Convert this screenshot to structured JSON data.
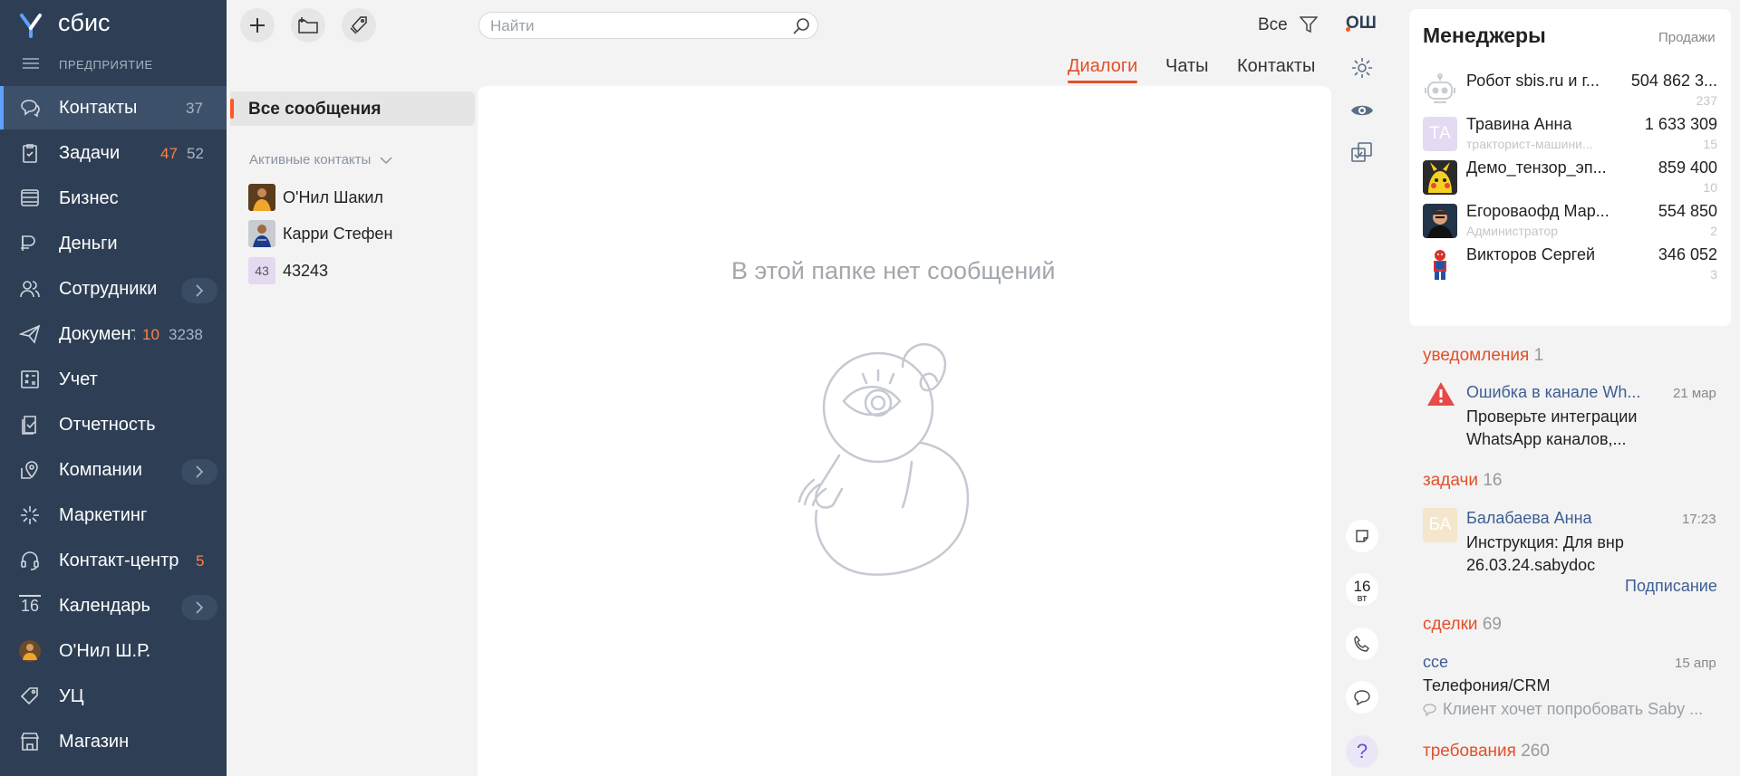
{
  "app": {
    "logo_text": "сбис",
    "org_label": "ПРЕДПРИЯТИЕ"
  },
  "sidebar": {
    "items": [
      {
        "label": "Контакты",
        "count": "37",
        "icon": "chat-bubbles-icon",
        "active": true
      },
      {
        "label": "Задачи",
        "count_alert": "47",
        "count": "52",
        "icon": "clipboard-check-icon"
      },
      {
        "label": "Бизнес",
        "icon": "stack-icon"
      },
      {
        "label": "Деньги",
        "icon": "coins-icon"
      },
      {
        "label": "Сотрудники",
        "icon": "people-icon",
        "expandable": true
      },
      {
        "label": "Документы",
        "count_alert": "10",
        "count": "3238",
        "icon": "send-icon"
      },
      {
        "label": "Учет",
        "icon": "calculator-icon"
      },
      {
        "label": "Отчетность",
        "icon": "report-icon"
      },
      {
        "label": "Компании",
        "icon": "location-building-icon",
        "expandable": true
      },
      {
        "label": "Маркетинг",
        "icon": "sparkle-icon"
      },
      {
        "label": "Контакт-центр",
        "count_alert": "5",
        "icon": "headset-icon"
      },
      {
        "label": "Календарь",
        "day": "16",
        "icon": "calendar-icon",
        "expandable": true
      },
      {
        "label": "О'Нил Ш.Р.",
        "icon": "user-avatar"
      },
      {
        "label": "УЦ",
        "icon": "tag-icon"
      },
      {
        "label": "Магазин",
        "icon": "shop-icon"
      }
    ]
  },
  "toolbar": {
    "search_placeholder": "Найти",
    "filter_label": "Все",
    "user_initials": "ОШ"
  },
  "tabs": [
    "Диалоги",
    "Чаты",
    "Контакты"
  ],
  "folders": {
    "all_messages": "Все сообщения",
    "active_contacts": "Активные контакты"
  },
  "contacts": [
    {
      "name": "О'Нил Шакил"
    },
    {
      "name": "Карри Стефен"
    },
    {
      "name": "43243",
      "badge": "43"
    }
  ],
  "main": {
    "empty_text": "В этой папке нет сообщений"
  },
  "rail": {
    "calendar_day": "16",
    "calendar_weekday": "вт",
    "help": "?"
  },
  "managers": {
    "title": "Менеджеры",
    "filter": "Продажи",
    "rows": [
      {
        "name": "Робот sbis.ru и г...",
        "sub": "",
        "sum": "504 862 3...",
        "n": "237"
      },
      {
        "name": "Травина Анна",
        "sub": "тракторист-машини...",
        "initials": "ТА",
        "sum": "1 633 309",
        "n": "15"
      },
      {
        "name": "Демо_тензор_эп...",
        "sub": "",
        "sum": "859 400",
        "n": "10"
      },
      {
        "name": "Егороваофд Мар...",
        "sub": "Администратор",
        "sum": "554 850",
        "n": "2"
      },
      {
        "name": "Викторов Сергей",
        "sub": "",
        "sum": "346 052",
        "n": "3"
      }
    ]
  },
  "feed": {
    "notifications": {
      "label": "уведомления",
      "count": "1",
      "title": "Ошибка в канале Wh...",
      "date": "21 мар",
      "text": "Проверьте интеграции WhatsApp каналов,..."
    },
    "tasks": {
      "label": "задачи",
      "count": "16",
      "initials": "БА",
      "title": "Балабаева Анна",
      "time": "17:23",
      "text": "Инструкция: Для внр 26.03.24.sabydoc",
      "action": "Подписание"
    },
    "deals": {
      "label": "сделки",
      "count": "69",
      "title": "ссе",
      "date": "15 апр",
      "text": "Телефония/CRM",
      "comment": "Клиент хочет попробовать Saby ..."
    },
    "requirements": {
      "label": "требования",
      "count": "260"
    }
  },
  "colors": {
    "sidebar_bg": "#2e3f55",
    "accent": "#e2502a",
    "link": "#3d5e94",
    "badge": "#ff7e4a"
  }
}
